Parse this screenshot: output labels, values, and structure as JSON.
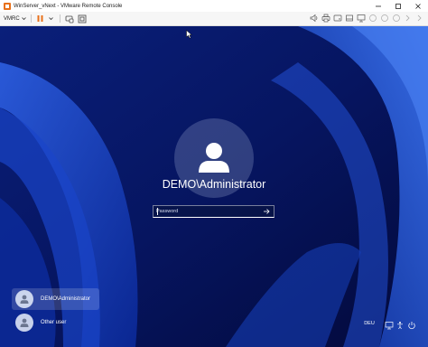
{
  "window": {
    "title": "WinServer_vNext - VMware Remote Console",
    "controls": [
      "minimize-icon",
      "maximize-icon",
      "close-icon"
    ]
  },
  "toolbar": {
    "menu_label": "VMRC",
    "left_icons": [
      "pause-icon",
      "send-keys-icon",
      "fit-screen-icon"
    ],
    "right_icons": [
      "sound-icon",
      "printer-icon",
      "disk-icon",
      "removable-device-icon",
      "network-icon",
      "usb-icon",
      "floppy-icon",
      "more-device-icon",
      "chevron-right-icon",
      "chevron-right-icon"
    ]
  },
  "login": {
    "username": "DEMO\\Administrator",
    "password_placeholder": "Password",
    "submit_icon": "arrow-right-icon"
  },
  "user_list": [
    {
      "label": "DEMO\\Administrator",
      "selected": true
    },
    {
      "label": "Other user",
      "selected": false
    }
  ],
  "status_bar": {
    "language": "DEU",
    "icons": [
      "network-icon",
      "accessibility-icon",
      "power-icon"
    ]
  },
  "colors": {
    "accent_orange": "#e8701a",
    "wallpaper_dark": "#061560",
    "wallpaper_light": "#2f63e8"
  }
}
